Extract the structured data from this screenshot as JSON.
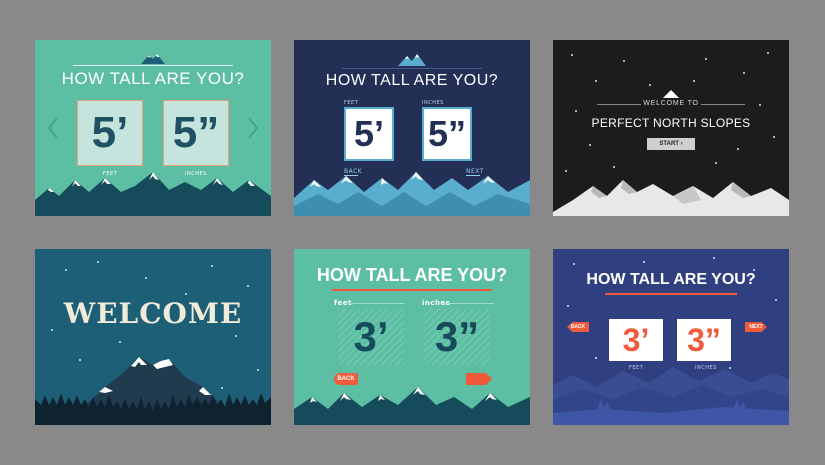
{
  "card1": {
    "title": "HOW TALL ARE YOU?",
    "feet_value": "5’",
    "inches_value": "5”",
    "feet_label": "FEET",
    "inches_label": "INCHES"
  },
  "card2": {
    "title": "HOW TALL ARE YOU?",
    "feet_label": "FEET",
    "inches_label": "INCHES",
    "feet_value": "5’",
    "inches_value": "5”",
    "back_label": "BACK",
    "next_label": "NEXT"
  },
  "card3": {
    "subtitle": "WELCOME TO",
    "title": "PERFECT NORTH SLOPES",
    "start_label": "START ›"
  },
  "card4": {
    "title": "WELCOME"
  },
  "card5": {
    "title": "HOW TALL ARE YOU?",
    "feet_label": "feet",
    "inches_label": "inches",
    "feet_value": "3’",
    "inches_value": "3”",
    "back_label": "BACK"
  },
  "card6": {
    "title": "HOW TALL ARE YOU?",
    "feet_value": "3’",
    "inches_value": "3”",
    "feet_label": "FEET",
    "inches_label": "INCHES",
    "back_label": "BACK",
    "next_label": "NEXT"
  },
  "colors": {
    "backdrop": "#898989",
    "mint": "#5cbfa3",
    "navy": "#232f55",
    "black": "#1c1c1c",
    "teal": "#1e5f78",
    "indigo": "#2f3f7f",
    "orange": "#ef5a3a",
    "dark_teal": "#154b5a"
  },
  "icons": {
    "mountain_logo": "mountain-logo-icon",
    "chevron_left": "chevron-left-icon",
    "chevron_right": "chevron-right-icon"
  }
}
